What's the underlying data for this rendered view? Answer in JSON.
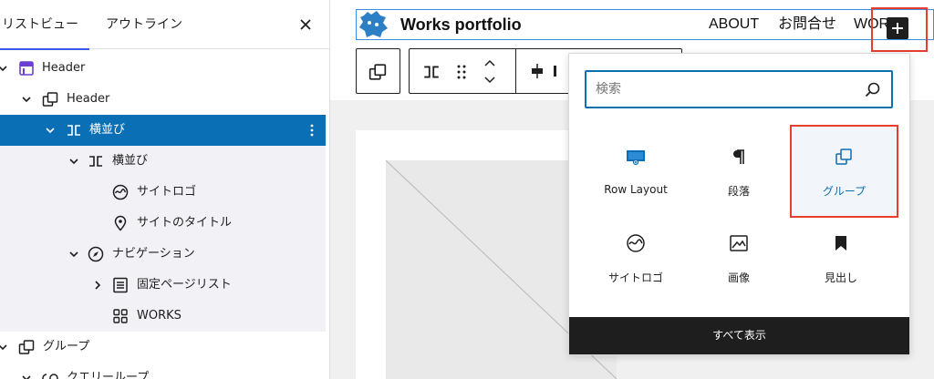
{
  "list_view": {
    "tabs": [
      "リストビュー",
      "アウトライン"
    ],
    "close_label": "×",
    "rows": [
      {
        "label": "Header",
        "icon": "template-part-icon",
        "expanded": true
      },
      {
        "label": "Header",
        "icon": "group-icon",
        "expanded": true
      },
      {
        "label": "横並び",
        "icon": "row-icon",
        "expanded": true,
        "selected": true
      },
      {
        "label": "横並び",
        "icon": "row-icon",
        "expanded": true
      },
      {
        "label": "サイトロゴ",
        "icon": "site-logo-icon"
      },
      {
        "label": "サイトのタイトル",
        "icon": "map-marker-icon"
      },
      {
        "label": "ナビゲーション",
        "icon": "compass-icon",
        "expanded": true
      },
      {
        "label": "固定ページリスト",
        "icon": "page-list-icon",
        "expanded": false
      },
      {
        "label": "WORKS",
        "icon": "grid-icon"
      },
      {
        "label": "グループ",
        "icon": "group-icon",
        "expanded": true
      },
      {
        "label": "クエリーループ",
        "icon": "loop-icon"
      }
    ]
  },
  "site_header": {
    "title": "Works portfolio",
    "nav": [
      "ABOUT",
      "お問合せ",
      "WOR"
    ],
    "add_button": "+"
  },
  "inserter": {
    "search_placeholder": "検索",
    "blocks": [
      {
        "label": "Row Layout",
        "icon": "row-layout-icon"
      },
      {
        "label": "段落",
        "icon": "paragraph-icon"
      },
      {
        "label": "グループ",
        "icon": "group-icon",
        "highlighted": true
      },
      {
        "label": "サイトロゴ",
        "icon": "site-logo-icon"
      },
      {
        "label": "画像",
        "icon": "image-icon"
      },
      {
        "label": "見出し",
        "icon": "bookmark-icon"
      }
    ],
    "show_all": "すべて表示"
  },
  "colors": {
    "accent": "#0b6fb5",
    "highlight_outline": "#e53e2f",
    "dark": "#1e1e1e",
    "template_icon": "#6c3fd1"
  }
}
